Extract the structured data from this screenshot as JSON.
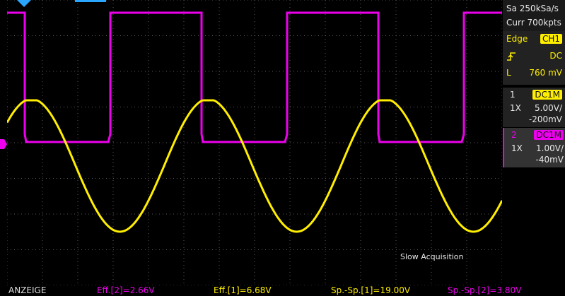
{
  "acq": {
    "sample_rate": "Sa 250kSa/s",
    "memory": "Curr 700kpts"
  },
  "trigger": {
    "mode": "Edge",
    "source": "CH1",
    "slope_icon": "rising-edge-icon",
    "coupling": "DC",
    "level_label": "L",
    "level": "760 mV"
  },
  "channels": [
    {
      "number": "1",
      "coupling": "DC1M",
      "probe": "1X",
      "volts_div": "5.00V/",
      "offset": "-200mV",
      "color": "#ffee00"
    },
    {
      "number": "2",
      "coupling": "DC1M",
      "probe": "1X",
      "volts_div": "1.00V/",
      "offset": "-40mV",
      "color": "#ee00ee"
    }
  ],
  "status": {
    "acquisition": "Slow Acquisition"
  },
  "bottom_bar": {
    "menu_label": "ANZEIGE",
    "measurements": [
      {
        "text": "Eff.[2]=2.66V",
        "color": "#ee00ee"
      },
      {
        "text": "Eff.[1]=6.68V",
        "color": "#ffee00"
      },
      {
        "text": "Sp.-Sp.[1]=19.00V",
        "color": "#ffee00"
      },
      {
        "text": "Sp.-Sp.[2]=3.80V",
        "color": "#ee00ee"
      }
    ]
  },
  "colors": {
    "ch1": "#ffee00",
    "ch2": "#ee00ee",
    "grid": "#5a5a5a",
    "panel_bg": "#222222"
  },
  "markers": {
    "trigger_position_icon": "trigger-position-marker-icon",
    "ch2_ground_icon": "ch2-ground-marker-icon"
  }
}
